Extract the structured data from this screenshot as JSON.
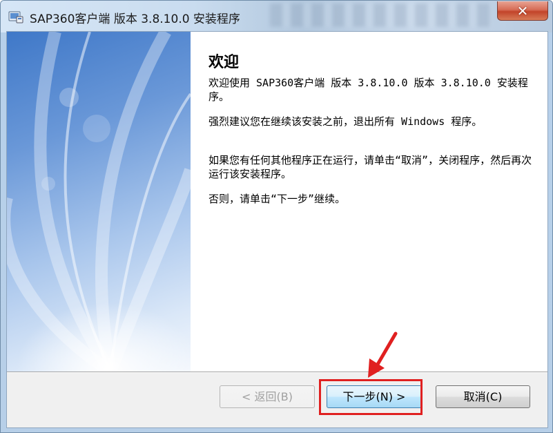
{
  "window": {
    "title": "SAP360客户端 版本 3.8.10.0 安装程序",
    "close_label": "✕"
  },
  "content": {
    "heading": "欢迎",
    "paragraphs": [
      "欢迎使用 SAP360客户端 版本 3.8.10.0 版本 3.8.10.0 安装程序。",
      "强烈建议您在继续该安装之前，退出所有 Windows 程序。",
      "如果您有任何其他程序正在运行，请单击“取消”，关闭程序，然后再次运行该安装程序。",
      "否则，请单击“下一步”继续。"
    ]
  },
  "buttons": {
    "back": "< 返回(B)",
    "next": "下一步(N) >",
    "cancel": "取消(C)"
  },
  "colors": {
    "highlight": "#e02020",
    "accent": "#3c7fb1"
  }
}
